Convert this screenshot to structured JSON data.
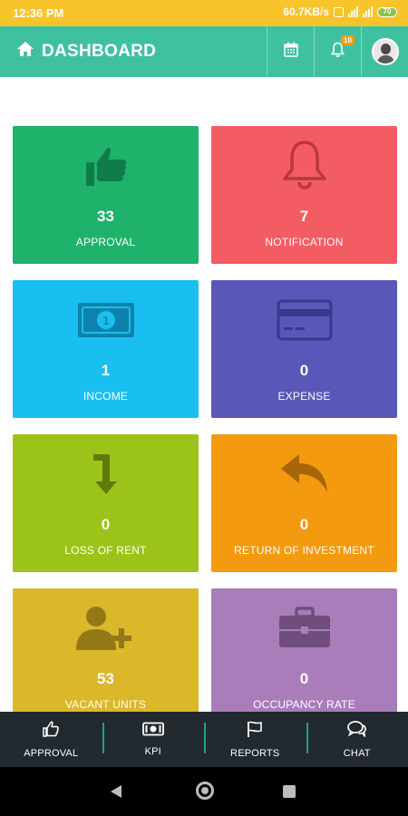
{
  "status_bar": {
    "time": "12:36 PM",
    "net_speed": "60.7KB/s",
    "battery": "70"
  },
  "app_bar": {
    "title": "DASHBOARD",
    "notification_count": "10"
  },
  "tiles": [
    {
      "id": "approval",
      "count": "33",
      "label": "APPROVAL",
      "color": "#1fb26b",
      "icon": "thumbs-up-icon"
    },
    {
      "id": "notification",
      "count": "7",
      "label": "NOTIFICATION",
      "color": "#f45c63",
      "icon": "bell-icon"
    },
    {
      "id": "income",
      "count": "1",
      "label": "INCOME",
      "color": "#18bff0",
      "icon": "money-bill-icon"
    },
    {
      "id": "expense",
      "count": "0",
      "label": "EXPENSE",
      "color": "#5957b8",
      "icon": "credit-card-icon"
    },
    {
      "id": "loss-of-rent",
      "count": "0",
      "label": "LOSS OF RENT",
      "color": "#9cc31a",
      "icon": "arrow-turn-down-icon"
    },
    {
      "id": "return-of-investment",
      "count": "0",
      "label": "RETURN OF INVESTMENT",
      "color": "#f49a0f",
      "icon": "reply-arrow-icon"
    },
    {
      "id": "vacant-units",
      "count": "53",
      "label": "VACANT UNITS",
      "color": "#dbb72a",
      "icon": "user-plus-icon"
    },
    {
      "id": "occupancy-rate",
      "count": "0",
      "label": "OCCUPANCY RATE",
      "color": "#a97cba",
      "icon": "briefcase-icon"
    }
  ],
  "bottom_nav": [
    {
      "label": "APPROVAL",
      "icon": "thumbs-up-icon"
    },
    {
      "label": "KPI",
      "icon": "money-bill-icon"
    },
    {
      "label": "REPORTS",
      "icon": "flag-icon"
    },
    {
      "label": "CHAT",
      "icon": "chat-bubbles-icon"
    }
  ],
  "colors": {
    "status_bar": "#f7c42a",
    "app_bar": "#3fc1a0",
    "bottom_nav": "#22292f",
    "nav_divider": "#1f9f86"
  }
}
